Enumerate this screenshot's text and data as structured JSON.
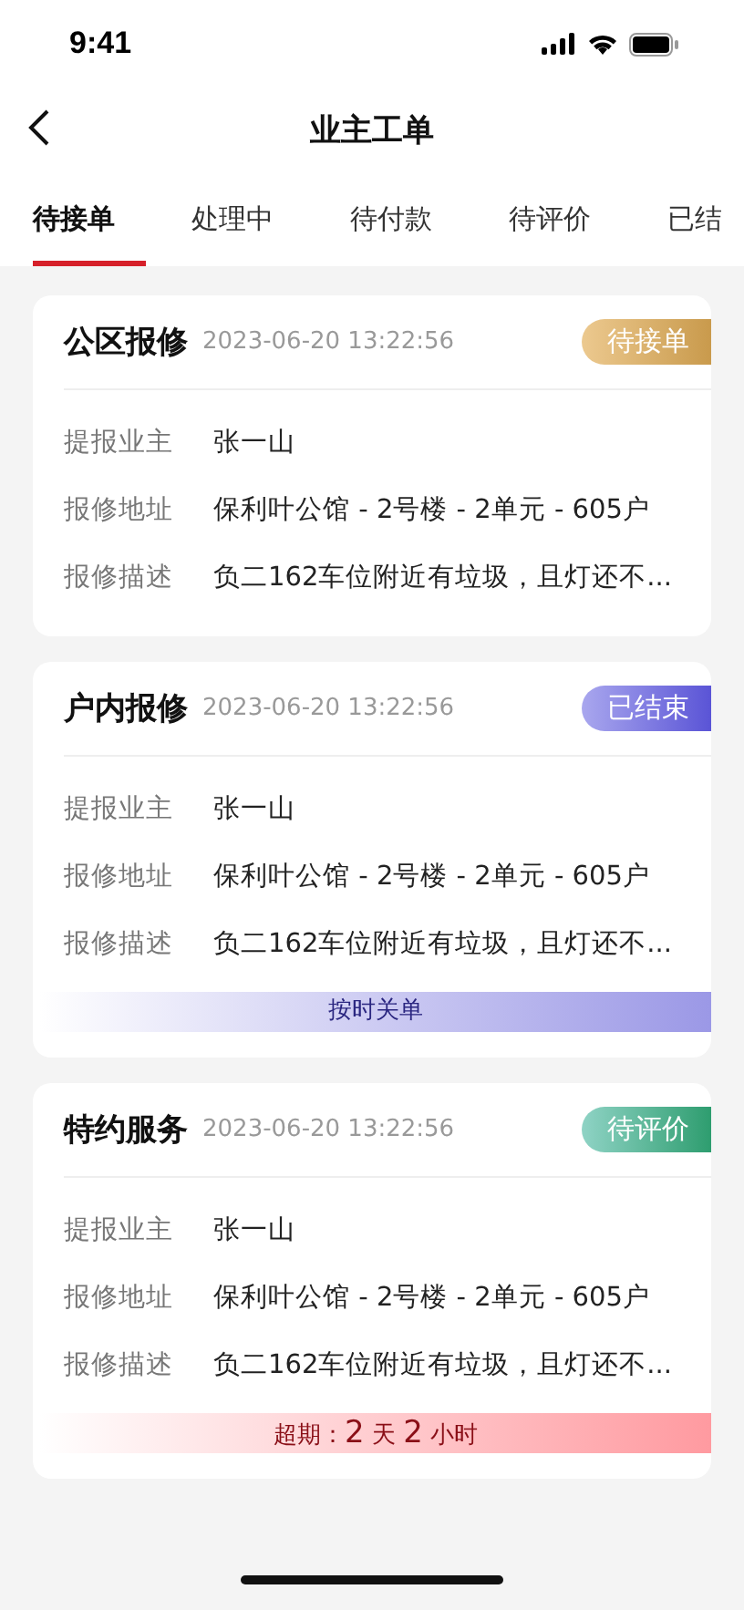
{
  "status_bar": {
    "time": "9:41"
  },
  "nav": {
    "title": "业主工单"
  },
  "tabs": [
    {
      "label": "待接单",
      "selected": true
    },
    {
      "label": "处理中",
      "selected": false
    },
    {
      "label": "待付款",
      "selected": false
    },
    {
      "label": "待评价",
      "selected": false
    },
    {
      "label": "已结",
      "selected": false
    }
  ],
  "orders": [
    {
      "type": "公区报修",
      "time": "2023-06-20 13:22:56",
      "status": {
        "label": "待接单",
        "kind": "pending"
      },
      "fields": [
        {
          "label": "提报业主",
          "value": "张一山"
        },
        {
          "label": "报修地址",
          "value": "保利叶公馆 - 2号楼 - 2单元 - 605户"
        },
        {
          "label": "报修描述",
          "value": "负二162车位附近有垃圾，且灯还不..."
        }
      ]
    },
    {
      "type": "户内报修",
      "time": "2023-06-20 13:22:56",
      "status": {
        "label": "已结束",
        "kind": "closed"
      },
      "fields": [
        {
          "label": "提报业主",
          "value": "张一山"
        },
        {
          "label": "报修地址",
          "value": "保利叶公馆 - 2号楼 - 2单元 - 605户"
        },
        {
          "label": "报修描述",
          "value": "负二162车位附近有垃圾，且灯还不..."
        }
      ],
      "footer": {
        "kind": "ontime",
        "text": "按时关单"
      }
    },
    {
      "type": "特约服务",
      "time": "2023-06-20 13:22:56",
      "status": {
        "label": "待评价",
        "kind": "review"
      },
      "fields": [
        {
          "label": "提报业主",
          "value": "张一山"
        },
        {
          "label": "报修地址",
          "value": "保利叶公馆 - 2号楼 - 2单元 - 605户"
        },
        {
          "label": "报修描述",
          "value": "负二162车位附近有垃圾，且灯还不..."
        }
      ],
      "footer": {
        "kind": "overdue",
        "text": "超期：**2** 天 **2** 小时"
      }
    }
  ]
}
